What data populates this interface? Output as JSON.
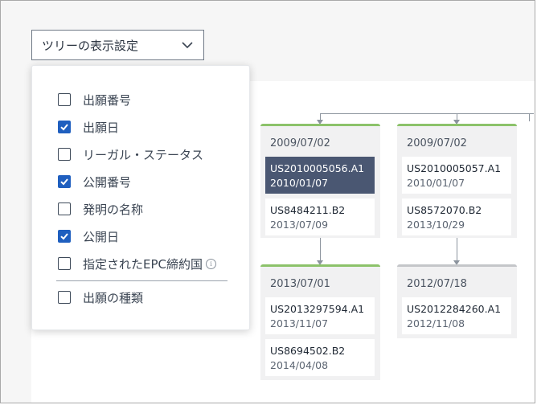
{
  "toolbar": {
    "tree_display_settings_label": "ツリーの表示設定"
  },
  "options": [
    {
      "label": "出願番号",
      "checked": false,
      "info": false
    },
    {
      "label": "出願日",
      "checked": true,
      "info": false
    },
    {
      "label": "リーガル・ステータス",
      "checked": false,
      "info": false
    },
    {
      "label": "公開番号",
      "checked": true,
      "info": false
    },
    {
      "label": "発明の名称",
      "checked": false,
      "info": false
    },
    {
      "label": "公開日",
      "checked": true,
      "info": false
    },
    {
      "label": "指定されたEPC締約国",
      "checked": false,
      "info": true
    },
    {
      "label": "出願の種類",
      "checked": false,
      "info": false
    }
  ],
  "tree": {
    "node1": {
      "date": "2009/07/02",
      "cards": [
        {
          "number": "US2010005056.A1",
          "date": "2010/01/07",
          "selected": true
        },
        {
          "number": "US8484211.B2",
          "date": "2013/07/09",
          "selected": false
        }
      ]
    },
    "node2": {
      "date": "2009/07/02",
      "cards": [
        {
          "number": "US2010005057.A1",
          "date": "2010/01/07",
          "selected": false
        },
        {
          "number": "US8572070.B2",
          "date": "2013/10/29",
          "selected": false
        }
      ]
    },
    "node3": {
      "date": "2013/07/01",
      "cards": [
        {
          "number": "US2013297594.A1",
          "date": "2013/11/07",
          "selected": false
        },
        {
          "number": "US8694502.B2",
          "date": "2014/04/08",
          "selected": false
        }
      ]
    },
    "node4": {
      "date": "2012/07/18",
      "cards": [
        {
          "number": "US2012284260.A1",
          "date": "2012/11/08",
          "selected": false
        }
      ]
    }
  },
  "colors": {
    "accent": "#1f5fbf",
    "selected_card": "#4a5772",
    "node_border_active": "#8cc26a",
    "node_border_inactive": "#c4c6c9"
  },
  "icons": {
    "dropdown": "chevron-down-icon",
    "checked": "checkmark-icon",
    "info": "info-icon"
  }
}
